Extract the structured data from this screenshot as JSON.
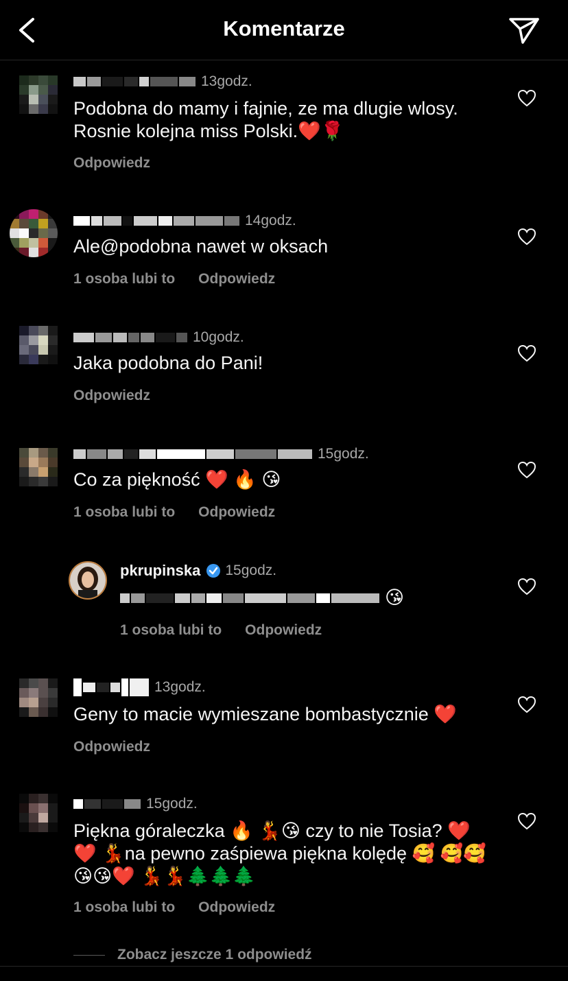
{
  "header": {
    "title": "Komentarze",
    "back_icon": "chevron-left-icon",
    "send_icon": "paper-plane-icon"
  },
  "comments": [
    {
      "time": "13godz.",
      "text": "Podobna do mamy i fajnie, ze ma dlugie wlosy. Rosnie kolejna miss Polski.❤️🌹",
      "likes": "",
      "reply": "Odpowiedz"
    },
    {
      "time": "14godz.",
      "text": "Ale@podobna nawet w oksach",
      "likes": "1 osoba lubi to",
      "reply": "Odpowiedz"
    },
    {
      "time": "10godz.",
      "text": "Jaka podobna do Pani!",
      "likes": "",
      "reply": "Odpowiedz"
    },
    {
      "time": "15godz.",
      "text": "Co za piękność ❤️ 🔥 😘",
      "likes": "1 osoba lubi to",
      "reply": "Odpowiedz"
    },
    {
      "username": "pkrupinska",
      "time": "15godz.",
      "text": "😘",
      "likes": "1 osoba lubi to",
      "reply": "Odpowiedz"
    },
    {
      "time": "13godz.",
      "text": "Geny to macie wymieszane bombastycznie ❤️",
      "likes": "",
      "reply": "Odpowiedz"
    },
    {
      "time": "15godz.",
      "text": "Piękna góraleczka 🔥 💃😘 czy to nie Tosia? ❤️ ❤️ 💃na pewno zaśpiewa piękna kolędę 🥰 🥰🥰😘😘❤️ 💃💃🌲🌲🌲",
      "likes": "1 osoba lubi to",
      "reply": "Odpowiedz"
    }
  ],
  "view_more": "Zobacz jeszcze 1 odpowiedź",
  "colors": {
    "background": "#000000",
    "text": "#f5f5f5",
    "secondary": "#8e8e8e",
    "verified": "#3897f0"
  }
}
